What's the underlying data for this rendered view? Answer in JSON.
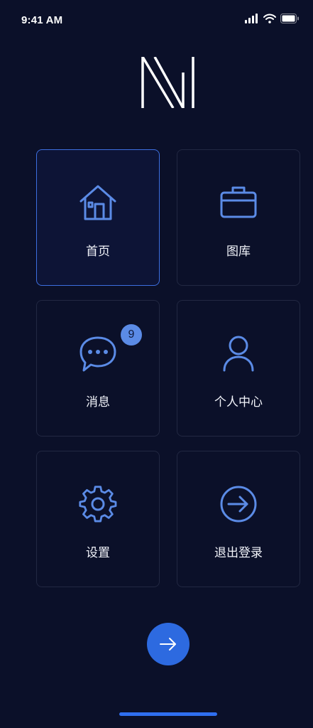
{
  "status_bar": {
    "time": "9:41 AM",
    "icons": [
      "cellular-signal-icon",
      "wifi-icon",
      "battery-icon"
    ]
  },
  "logo": {
    "icon": "brand-logo-icon"
  },
  "tiles": [
    {
      "label": "首页",
      "icon": "home-icon",
      "active": true
    },
    {
      "label": "图库",
      "icon": "briefcase-icon",
      "active": false
    },
    {
      "label": "消息",
      "icon": "chat-icon",
      "active": false,
      "badge": "9"
    },
    {
      "label": "个人中心",
      "icon": "user-icon",
      "active": false
    },
    {
      "label": "设置",
      "icon": "gear-icon",
      "active": false
    },
    {
      "label": "退出登录",
      "icon": "arrow-right-circle-icon",
      "active": false
    }
  ],
  "fab": {
    "icon": "arrow-right-icon"
  },
  "colors": {
    "background": "#0b1029",
    "accent": "#2d6ae0",
    "icon_blue": "#5b8be6",
    "tile_border": "#222842",
    "badge": "#5b8be6"
  }
}
